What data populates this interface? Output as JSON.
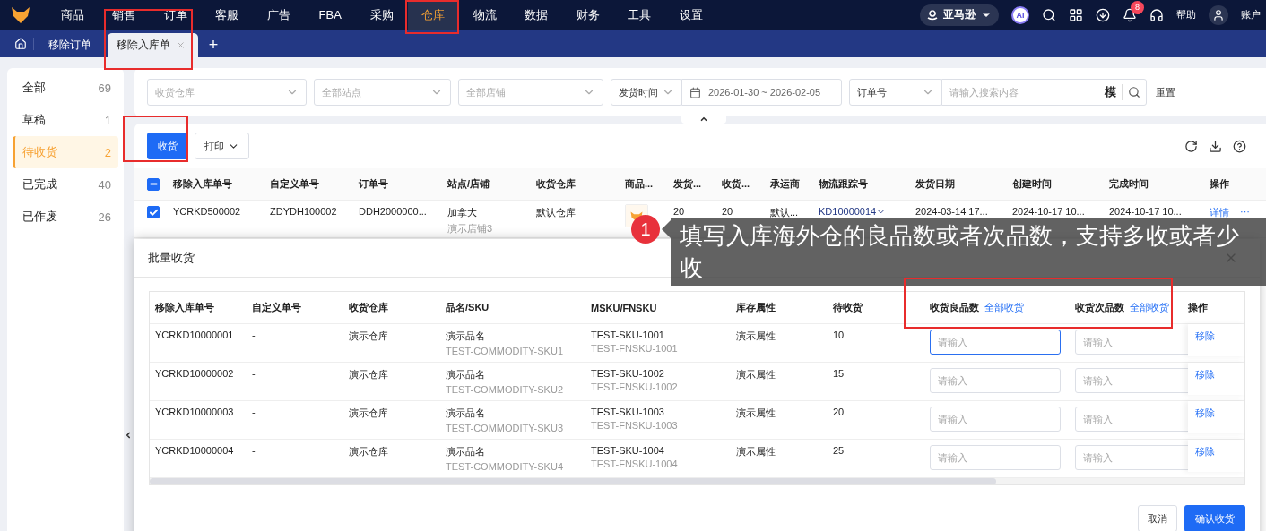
{
  "top_nav": {
    "menu": [
      {
        "label": "商品",
        "selected": false
      },
      {
        "label": "销售",
        "selected": false
      },
      {
        "label": "订单",
        "selected": false
      },
      {
        "label": "客服",
        "selected": false
      },
      {
        "label": "广告",
        "selected": false
      },
      {
        "label": "FBA",
        "selected": false
      },
      {
        "label": "采购",
        "selected": false
      },
      {
        "label": "仓库",
        "selected": true
      },
      {
        "label": "物流",
        "selected": false
      },
      {
        "label": "数据",
        "selected": false
      },
      {
        "label": "财务",
        "selected": false
      },
      {
        "label": "工具",
        "selected": false
      },
      {
        "label": "设置",
        "selected": false
      }
    ],
    "platform": "亚马逊",
    "ai": "AI",
    "notifications": "8",
    "help": "帮助",
    "account": "账户"
  },
  "tab_bar": {
    "tabs": [
      {
        "label": "移除订单",
        "selected": false
      },
      {
        "label": "移除入库单",
        "selected": true
      }
    ],
    "add": "+"
  },
  "status_list": [
    {
      "label": "全部",
      "count": "69",
      "selected": false
    },
    {
      "label": "草稿",
      "count": "1",
      "selected": false
    },
    {
      "label": "待收货",
      "count": "2",
      "selected": true
    },
    {
      "label": "已完成",
      "count": "40",
      "selected": false
    },
    {
      "label": "已作废",
      "count": "26",
      "selected": false
    }
  ],
  "filters": {
    "warehouse": {
      "placeholder": "收货仓库"
    },
    "site": {
      "placeholder": "全部站点"
    },
    "shop": {
      "placeholder": "全部店铺"
    },
    "date_type": "发货时间",
    "date_range": "2026-01-30 ~ 2026-02-05",
    "search_type": "订单号",
    "search": {
      "placeholder": "请输入搜索内容"
    },
    "match_mode": "模",
    "reset": "重置"
  },
  "toolbar": {
    "primary": "收货",
    "print": "打印"
  },
  "orders_table": {
    "select_all_indeterminate": true,
    "columns": [
      "移除入库单号",
      "自定义单号",
      "订单号",
      "站点/店铺",
      "收货仓库",
      "商品...",
      "发货...",
      "收货...",
      "承运商",
      "物流跟踪号",
      "发货日期",
      "创建时间",
      "完成时间",
      "操作"
    ],
    "rows": [
      {
        "checked": true,
        "order_no": "YCRKD500002",
        "custom_no": "ZDYDH100002",
        "order_id": "DDH2000000...",
        "site": "加拿大",
        "shop": "演示店铺3",
        "warehouse": "默认仓库",
        "shipped": "20",
        "received": "20",
        "carrier": "默认...",
        "tracking": "KD10000014",
        "ship_date": "2024-03-14 17...",
        "created": "2024-10-17 10...",
        "completed": "2024-10-17 10...",
        "detail": "详情",
        "more": "···"
      }
    ]
  },
  "modal": {
    "title": "批量收货",
    "columns": [
      {
        "label": "移除入库单号"
      },
      {
        "label": "自定义单号"
      },
      {
        "label": "收货仓库"
      },
      {
        "label": "品名/SKU"
      },
      {
        "label": "MSKU/FNSKU"
      },
      {
        "label": "库存属性"
      },
      {
        "label": "待收货"
      },
      {
        "label": "收货良品数",
        "action": "全部收货"
      },
      {
        "label": "收货次品数",
        "action": "全部收货"
      },
      {
        "label": "操作"
      }
    ],
    "rows": [
      {
        "order_no": "YCRKD10000001",
        "custom_no": "-",
        "warehouse": "演示仓库",
        "name": "演示品名",
        "sku": "TEST-COMMODITY-SKU1",
        "msku": "TEST-SKU-1001",
        "fnsku": "TEST-FNSKU-1001",
        "attribute": "演示属性",
        "pending": "10",
        "good": {
          "placeholder": "请输入",
          "focused": true
        },
        "defect": {
          "placeholder": "请输入",
          "focused": false
        },
        "action": "移除"
      },
      {
        "order_no": "YCRKD10000002",
        "custom_no": "-",
        "warehouse": "演示仓库",
        "name": "演示品名",
        "sku": "TEST-COMMODITY-SKU2",
        "msku": "TEST-SKU-1002",
        "fnsku": "TEST-FNSKU-1002",
        "attribute": "演示属性",
        "pending": "15",
        "good": {
          "placeholder": "请输入",
          "focused": false
        },
        "defect": {
          "placeholder": "请输入",
          "focused": false
        },
        "action": "移除"
      },
      {
        "order_no": "YCRKD10000003",
        "custom_no": "-",
        "warehouse": "演示仓库",
        "name": "演示品名",
        "sku": "TEST-COMMODITY-SKU3",
        "msku": "TEST-SKU-1003",
        "fnsku": "TEST-FNSKU-1003",
        "attribute": "演示属性",
        "pending": "20",
        "good": {
          "placeholder": "请输入",
          "focused": false
        },
        "defect": {
          "placeholder": "请输入",
          "focused": false
        },
        "action": "移除"
      },
      {
        "order_no": "YCRKD10000004",
        "custom_no": "-",
        "warehouse": "演示仓库",
        "name": "演示品名",
        "sku": "TEST-COMMODITY-SKU4",
        "msku": "TEST-SKU-1004",
        "fnsku": "TEST-FNSKU-1004",
        "attribute": "演示属性",
        "pending": "25",
        "good": {
          "placeholder": "请输入",
          "focused": false
        },
        "defect": {
          "placeholder": "请输入",
          "focused": false
        },
        "action": "移除"
      }
    ],
    "cancel": "取消",
    "confirm": "确认收货"
  },
  "guide_tip": {
    "step": "1",
    "text": "填写入库海外仓的良品数或者次品数，支持多收或者少收"
  }
}
